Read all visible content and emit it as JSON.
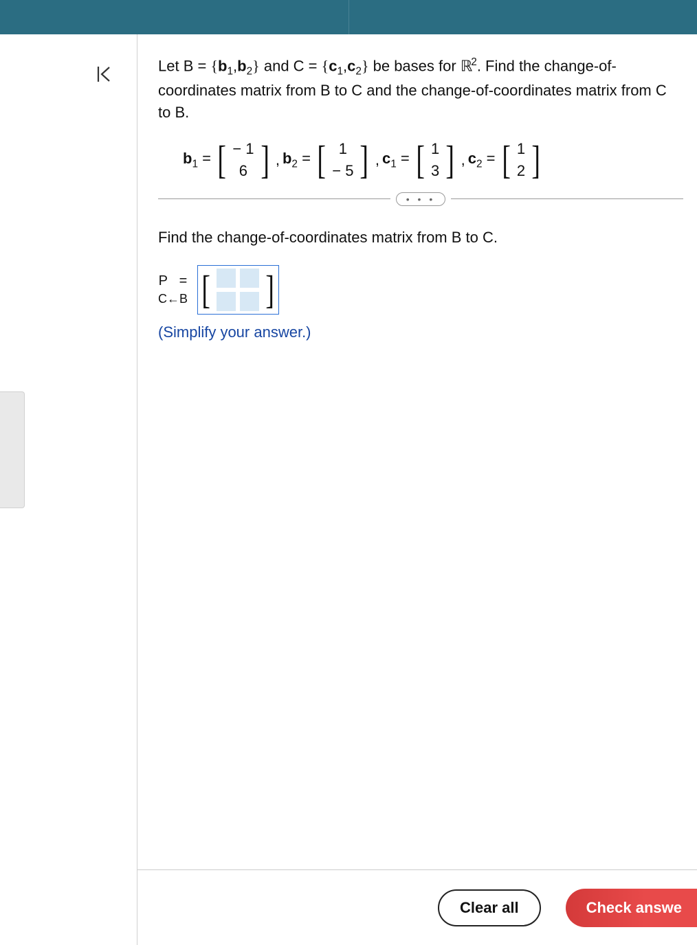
{
  "problem": {
    "intro_1": "Let B = ",
    "set_B_open": "{",
    "b1_sym": "b",
    "b1_idx": "1",
    "set_sep": ",",
    "b2_sym": "b",
    "b2_idx": "2",
    "set_B_close": "}",
    "intro_2": " and C = ",
    "set_C_open": "{",
    "c1_sym": "c",
    "c1_idx": "1",
    "c2_sym": "c",
    "c2_idx": "2",
    "set_C_close": "}",
    "intro_3": " be bases for ",
    "space_R": "ℝ",
    "space_dim": "2",
    "intro_4": ". Find the change-of-coordinates matrix from B to C and the change-of-coordinates matrix from C to B."
  },
  "vectors": {
    "b1_label": "b",
    "b1_sub": "1",
    "eq": " = ",
    "b1_top": "− 1",
    "b1_bot": "6",
    "comma": ", ",
    "b2_label": "b",
    "b2_sub": "2",
    "b2_top": "1",
    "b2_bot": "− 5",
    "c1_label": "c",
    "c1_sub": "1",
    "c1_top": "1",
    "c1_bot": "3",
    "c2_label": "c",
    "c2_sub": "2",
    "c2_top": "1",
    "c2_bot": "2"
  },
  "divider": {
    "dots": "• • •"
  },
  "subprompt": "Find the change-of-coordinates matrix from B to C.",
  "answer": {
    "P": "P",
    "eq": "=",
    "C": "C",
    "arrow": "←",
    "B": "B",
    "simplify": "(Simplify your answer.)"
  },
  "buttons": {
    "clear": "Clear all",
    "check": "Check answe"
  }
}
